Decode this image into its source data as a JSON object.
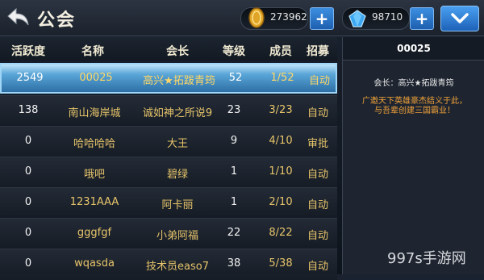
{
  "header": {
    "title": "公会",
    "gold": "273962",
    "gems": "98710"
  },
  "table": {
    "columns": [
      "活跃度",
      "名称",
      "会长",
      "等级",
      "成员",
      "招募"
    ],
    "rows": [
      {
        "activity": "2549",
        "name": "00025",
        "leader": "高兴★拓跋青筠",
        "level": "52",
        "members": "1/52",
        "recruit": "自动"
      },
      {
        "activity": "138",
        "name": "南山海岸城",
        "leader": "诚如神之所说9",
        "level": "23",
        "members": "3/23",
        "recruit": "自动"
      },
      {
        "activity": "0",
        "name": "哈哈哈哈",
        "leader": "大王",
        "level": "9",
        "members": "4/10",
        "recruit": "审批"
      },
      {
        "activity": "0",
        "name": "哦吧",
        "leader": "碧绿",
        "level": "1",
        "members": "1/10",
        "recruit": "自动"
      },
      {
        "activity": "0",
        "name": "1231AAA",
        "leader": "阿卡丽",
        "level": "1",
        "members": "2/10",
        "recruit": "自动"
      },
      {
        "activity": "0",
        "name": "gggfgf",
        "leader": "小弟阿福",
        "level": "22",
        "members": "8/22",
        "recruit": "自动"
      },
      {
        "activity": "0",
        "name": "wqasda",
        "leader": "技术员easo7",
        "level": "38",
        "members": "5/38",
        "recruit": "自动"
      }
    ]
  },
  "detail": {
    "guild_id": "00025",
    "leader_line": "会长：高兴★拓跋青筠",
    "notice": "广邀天下英雄豪杰结义于此，与吾辈创建三国霸业！"
  },
  "watermark": "997s手游网"
}
